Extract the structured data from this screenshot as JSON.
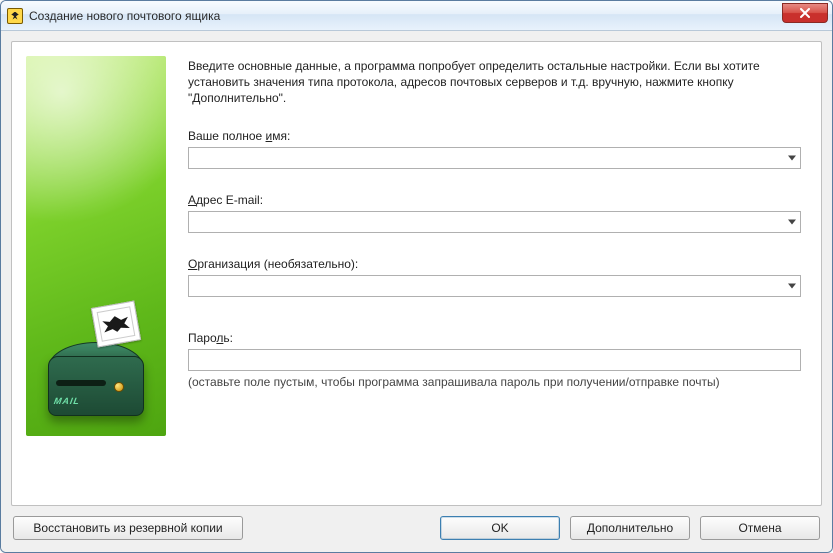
{
  "window": {
    "title": "Создание нового почтового ящика"
  },
  "intro": "Введите основные данные, а программа попробует определить остальные настройки. Если вы хотите установить значения типа протокола, адресов почтовых серверов и т.д. вручную, нажмите кнопку \"Дополнительно\".",
  "fields": {
    "full_name": {
      "label_pre": "Ваше полное ",
      "label_u": "и",
      "label_post": "мя:",
      "value": ""
    },
    "email": {
      "label_pre": "",
      "label_u": "А",
      "label_post": "дрес E-mail:",
      "value": ""
    },
    "org": {
      "label_pre": "",
      "label_u": "О",
      "label_post": "рганизация (необязательно):",
      "value": ""
    },
    "password": {
      "label_pre": "Паро",
      "label_u": "л",
      "label_post": "ь:",
      "value": "",
      "hint": "(оставьте поле пустым, чтобы программа запрашивала пароль при получении/отправке почты)"
    }
  },
  "buttons": {
    "restore": "Восстановить из резервной копии",
    "ok": "OK",
    "advanced": "Дополнительно",
    "cancel": "Отмена"
  },
  "mailbox_text": "MAIL"
}
